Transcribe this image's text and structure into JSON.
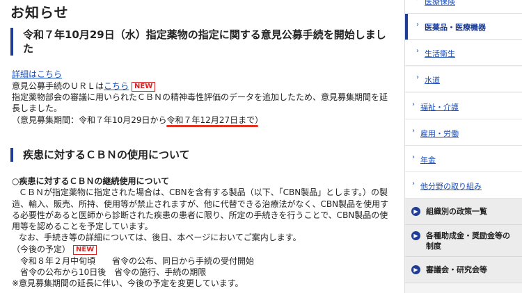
{
  "main": {
    "page_title": "お知らせ",
    "notice1": {
      "heading_line1": "令和７年10月29日（水）指定薬物の指定に関する意見公募手続を開始しまし",
      "heading_line2": "た",
      "detail_link": "詳細はこちら",
      "url_prefix": "意見公募手続のＵＲＬは",
      "url_link": "こちら",
      "new_badge": "NEW",
      "desc_line1": "指定薬物部会の審議に用いられたＣＢＮの精神毒性評価のデータを追加したため、意見募集期間を延",
      "desc_line2": "長しました。",
      "period_prefix": "（意見募集期間：令和７年10月29日から",
      "period_end": "令和７年12月27日まで",
      "period_close": "）"
    },
    "notice2": {
      "heading": "疾患に対するＣＢＮの使用について",
      "sub_heading": "○疾患に対するＣＢＮの継続使用について",
      "body_line1": "ＣＢＮが指定薬物に指定された場合は、CBNを含有する製品（以下、「CBN製品」とします。）の製",
      "body_line2": "造、輸入、販売、所持、使用等が禁止されますが、他に代替できる治療法がなく、CBN製品を使用す",
      "body_line3": "る必要性があると医師から診断された疾患の患者に限り、所定の手続きを行うことで、CBN製品の使",
      "body_line4": "用等を認めることを予定しています。",
      "body_line5": "なお、手続き等の詳細については、後日、本ページにおいてご案内します。",
      "schedule_label": "（今後の予定）",
      "new_badge": "NEW",
      "schedule_line1": "令和８年２月中旬頃　　省令の公布、同日から手続の受付開始",
      "schedule_line2": "省令の公布から10日後　省令の施行、手続の期限",
      "note": "※意見募集期間の延長に伴い、今後の予定を変更しています。"
    }
  },
  "sidebar": {
    "sub_items": [
      {
        "label": "医療保険"
      },
      {
        "label": "医薬品・医療機器"
      },
      {
        "label": "生活衛生"
      },
      {
        "label": "水道"
      }
    ],
    "sections": [
      {
        "label": "福祉・介護"
      },
      {
        "label": "雇用・労働"
      },
      {
        "label": "年金"
      },
      {
        "label": "他分野の取り組み"
      }
    ],
    "blocks": [
      {
        "label": "組織別の政策一覧"
      },
      {
        "label": "各種助成金・奨励金等の制度"
      },
      {
        "label": "審議会・研究会等"
      }
    ]
  },
  "colors": {
    "accent": "#1f3c96",
    "link": "#1a4fbd",
    "new_badge": "#d62424",
    "highlight_underline": "#e53323"
  }
}
